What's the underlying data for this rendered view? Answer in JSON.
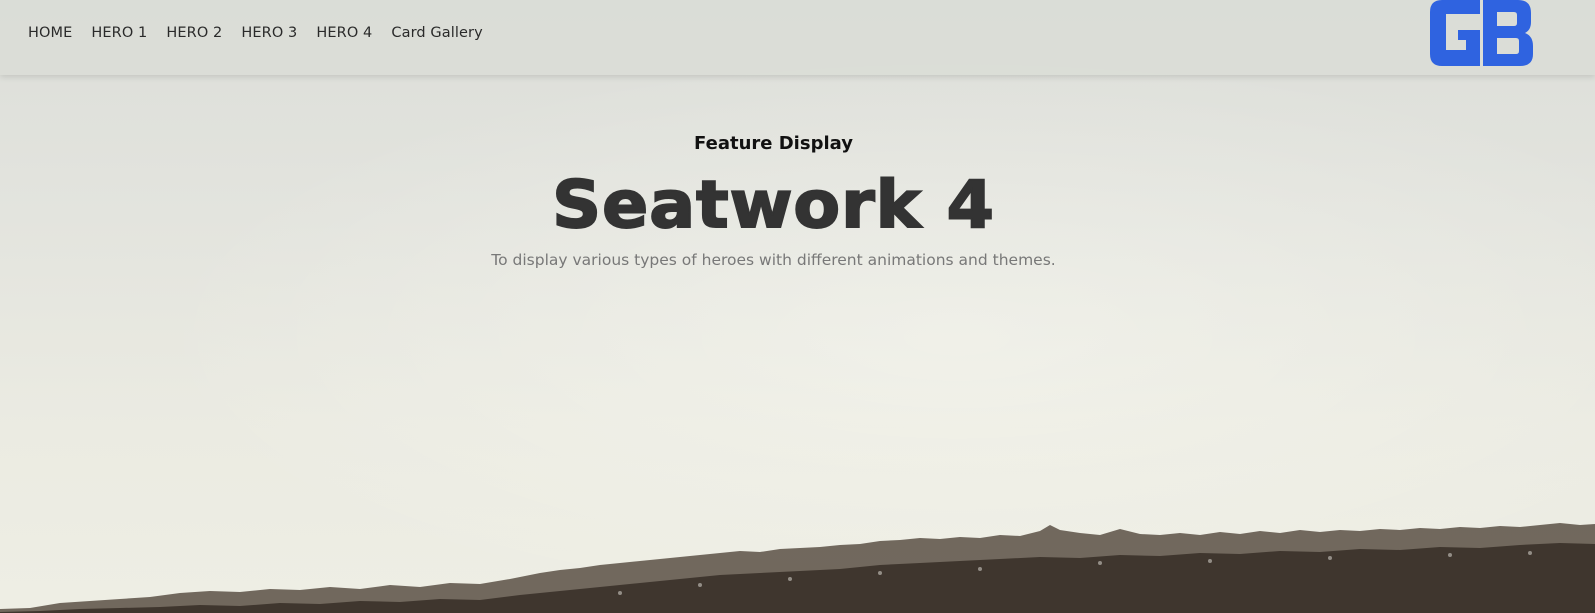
{
  "nav": {
    "items": [
      {
        "label": "HOME"
      },
      {
        "label": "HERO 1"
      },
      {
        "label": "HERO 2"
      },
      {
        "label": "HERO 3"
      },
      {
        "label": "HERO 4"
      },
      {
        "label": "Card Gallery"
      }
    ]
  },
  "logo": {
    "text": "GB",
    "color": "#2f63e0"
  },
  "hero": {
    "eyebrow": "Feature Display",
    "title": "Seatwork 4",
    "subtitle": "To display various types of heroes with different animations and themes."
  },
  "background": {
    "sky_color": "#e3e4de",
    "tree_color": "#4a4036"
  }
}
